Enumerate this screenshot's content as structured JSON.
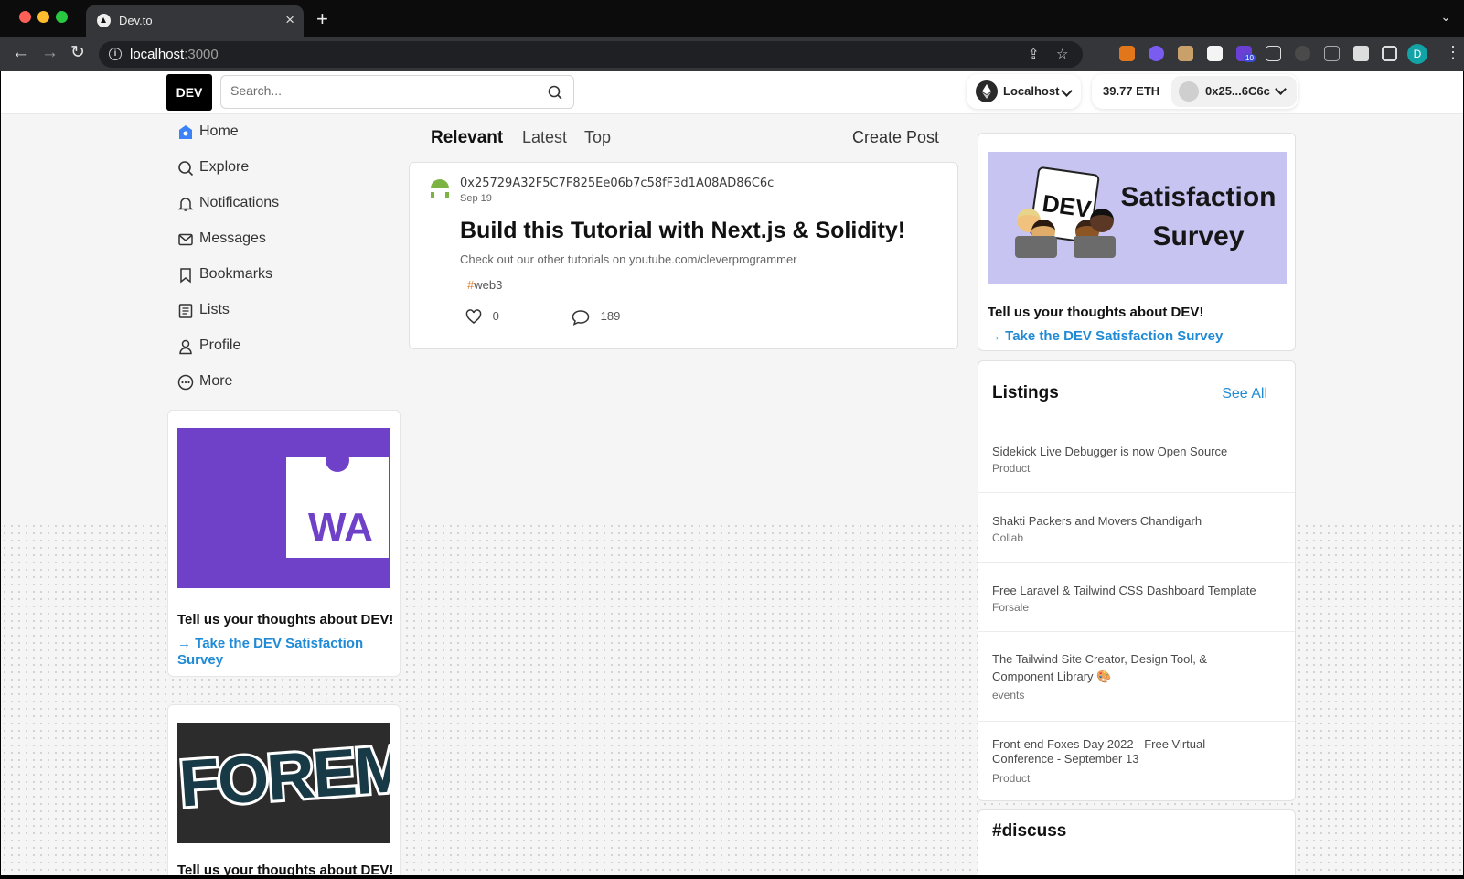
{
  "browser": {
    "tab_title": "Dev.to",
    "url_host": "localhost",
    "url_port": ":3000",
    "extension_badge": "10",
    "profile_initial": "D"
  },
  "header": {
    "logo": "DEV",
    "search_placeholder": "Search...",
    "network": "Localhost",
    "balance": "39.77 ETH",
    "address": "0x25...6C6c"
  },
  "left_nav": {
    "items": [
      {
        "label": "Home",
        "icon": "home-icon"
      },
      {
        "label": "Explore",
        "icon": "search-icon"
      },
      {
        "label": "Notifications",
        "icon": "bell-icon"
      },
      {
        "label": "Messages",
        "icon": "mail-icon"
      },
      {
        "label": "Bookmarks",
        "icon": "bookmark-icon"
      },
      {
        "label": "Lists",
        "icon": "list-icon"
      },
      {
        "label": "Profile",
        "icon": "user-icon"
      },
      {
        "label": "More",
        "icon": "more-icon"
      }
    ]
  },
  "left_cards": [
    {
      "image_text": "WA",
      "heading": "Tell us your thoughts about DEV!",
      "link": "→ Take the DEV Satisfaction Survey"
    },
    {
      "image_text": "FOREM",
      "heading": "Tell us your thoughts about DEV!"
    }
  ],
  "feed": {
    "tabs": [
      "Relevant",
      "Latest",
      "Top"
    ],
    "create_post": "Create Post",
    "post": {
      "author": "0x25729A32F5C7F825Ee06b7c58fF3d1A08AD86C6c",
      "date": "Sep 19",
      "title": "Build this Tutorial with Next.js & Solidity!",
      "description": "Check out our other tutorials on youtube.com/cleverprogrammer",
      "tag_hash": "#",
      "tag": "web3",
      "likes": "0",
      "comments": "189"
    }
  },
  "right": {
    "survey": {
      "image_title_line1": "Satisfaction",
      "image_title_line2": "Survey",
      "image_badge": "DEV",
      "heading": "Tell us your thoughts about DEV!",
      "link": "→ Take the DEV Satisfaction Survey"
    },
    "listings": {
      "title": "Listings",
      "see_all": "See All",
      "items": [
        {
          "title": "Sidekick Live Debugger is now Open Source",
          "category": "Product"
        },
        {
          "title": "Shakti Packers and Movers Chandigarh",
          "category": "Collab"
        },
        {
          "title": "Free Laravel & Tailwind CSS Dashboard Template",
          "category": "Forsale"
        },
        {
          "title": "The Tailwind Site Creator, Design Tool, & Component Library 🎨",
          "category": "events"
        },
        {
          "title": "Front-end Foxes Day 2022 - Free Virtual Conference - September 13",
          "category": "Product"
        }
      ]
    },
    "discuss": "#discuss"
  },
  "colors": {
    "accent_link": "#1f8ad6",
    "tag_hash": "#d9822b",
    "wa_purple": "#6f40c8",
    "survey_bg": "#c7c4f2"
  }
}
